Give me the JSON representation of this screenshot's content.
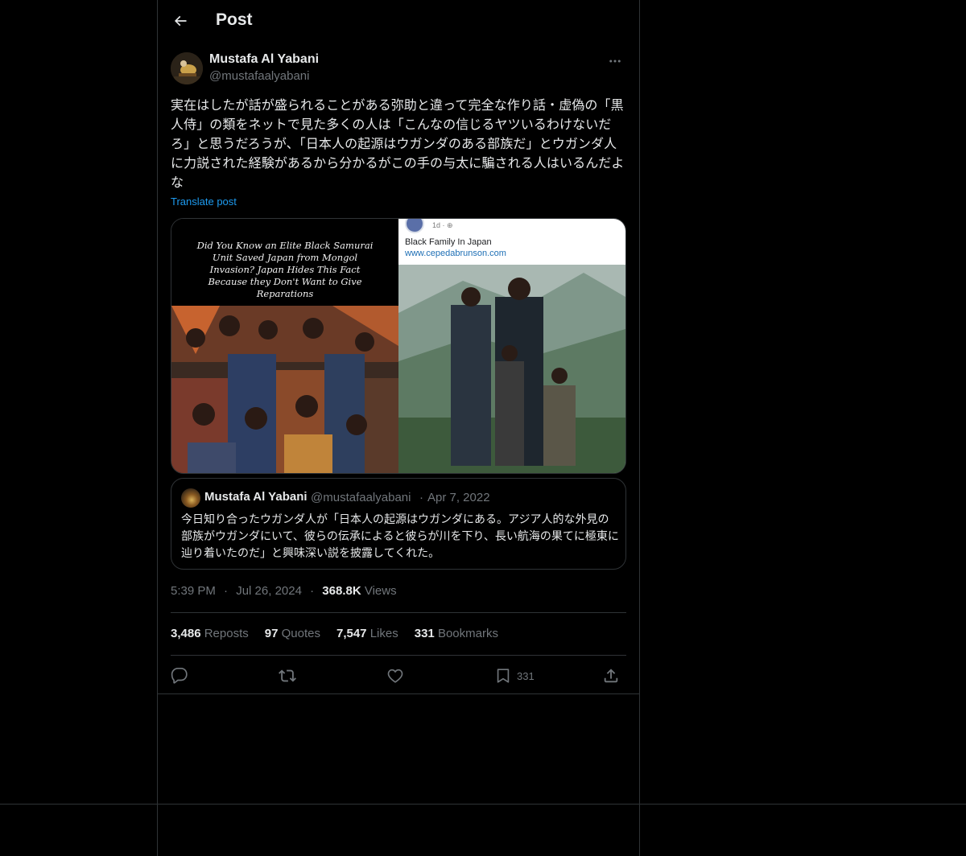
{
  "header": {
    "title": "Post"
  },
  "author": {
    "display_name": "Mustafa Al Yabani",
    "handle": "@mustafaalyabani"
  },
  "post": {
    "text": "実在はしたが話が盛られることがある弥助と違って完全な作り話・虚偽の「黒人侍」の類をネットで見た多くの人は「こんなの信じるヤツいるわけないだろ」と思うだろうが、「日本人の起源はウガンダのある部族だ」とウガンダ人に力説された経験があるから分かるがこの手の与太に騙される人はいるんだよな",
    "translate_label": "Translate post"
  },
  "media": {
    "left_caption": "Did You Know an Elite Black Samurai Unit Saved Japan from Mongol Invasion? Japan Hides This Fact Because they Don't Want to Give Reparations",
    "right_time": "1d · ⊕",
    "right_title": "Black Family In Japan",
    "right_link": "www.cepedabrunson.com"
  },
  "quote": {
    "display_name": "Mustafa Al Yabani",
    "handle": "@mustafaalyabani",
    "separator": "·",
    "date": "Apr 7, 2022",
    "text": "今日知り合ったウガンダ人が「日本人の起源はウガンダにある。アジア人的な外見の部族がウガンダにいて、彼らの伝承によると彼らが川を下り、長い航海の果てに極東に辿り着いたのだ」と興味深い説を披露してくれた。"
  },
  "meta": {
    "time": "5:39 PM",
    "date": "Jul 26, 2024",
    "separator": "·",
    "views_count": "368.8K",
    "views_label": "Views"
  },
  "stats": {
    "reposts_count": "3,486",
    "reposts_label": "Reposts",
    "quotes_count": "97",
    "quotes_label": "Quotes",
    "likes_count": "7,547",
    "likes_label": "Likes",
    "bookmarks_count": "331",
    "bookmarks_label": "Bookmarks"
  },
  "actions": {
    "bookmark_count": "331"
  },
  "icons": [
    "back-arrow-icon",
    "more-icon",
    "reply-icon",
    "repost-icon",
    "like-icon",
    "bookmark-icon",
    "share-icon"
  ],
  "colors": {
    "background": "#000000",
    "text": "#e7e9ea",
    "secondary": "#71767b",
    "accent": "#1d9bf0",
    "border": "#2f3336"
  }
}
